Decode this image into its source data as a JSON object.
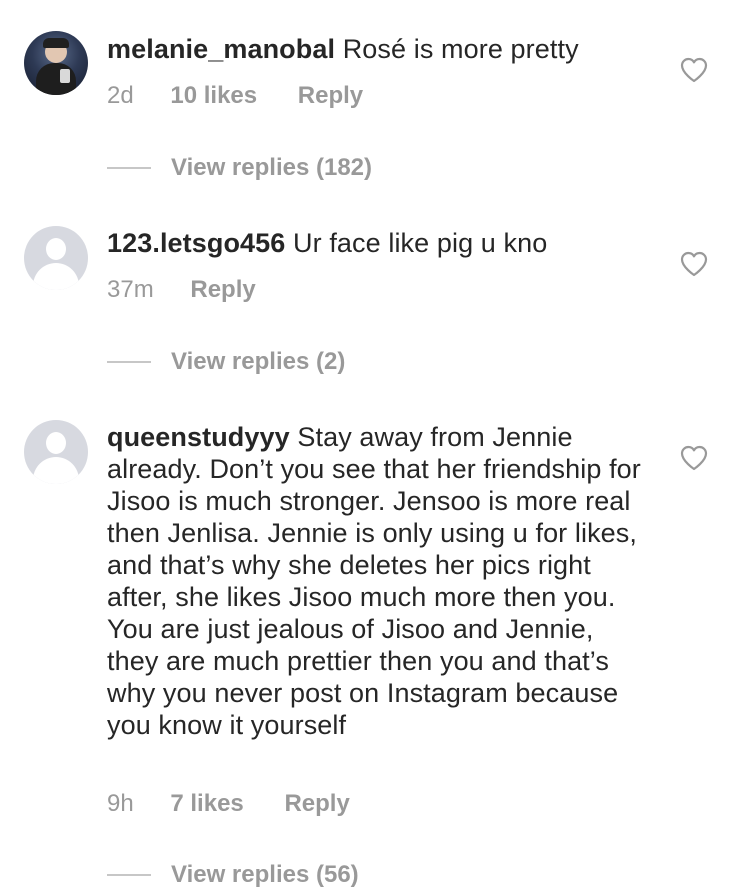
{
  "comments": [
    {
      "username": "melanie_manobal",
      "text": "Rosé is more pretty",
      "time": "2d",
      "likes": "10 likes",
      "reply_label": "Reply",
      "avatar": "photo",
      "view_replies": "View replies (182)",
      "like_icon": "heart-outline-icon"
    },
    {
      "username": "123.letsgo456",
      "text": "Ur face like pig u kno",
      "time": "37m",
      "likes": "",
      "reply_label": "Reply",
      "avatar": "default-profile",
      "view_replies": "View replies (2)",
      "like_icon": "heart-outline-icon"
    },
    {
      "username": "queenstudyyy",
      "text": "Stay away from Jennie already. Don’t you see that her friendship for Jisoo is much stronger. Jensoo is more real then Jenlisa. Jennie is only using u for likes, and that’s why she deletes her pics right after, she likes Jisoo much more then you. You are just jealous of Jisoo and Jennie, they are much prettier then you and that’s why you never post on Instagram because you know it yourself",
      "time": "9h",
      "likes": "7 likes",
      "reply_label": "Reply",
      "avatar": "default-profile",
      "view_replies": "View replies (56)",
      "like_icon": "heart-outline-icon"
    }
  ],
  "colors": {
    "text": "#262626",
    "secondary": "#999999",
    "divider": "#c7c7c7",
    "default_avatar": "#d7d9e0"
  }
}
